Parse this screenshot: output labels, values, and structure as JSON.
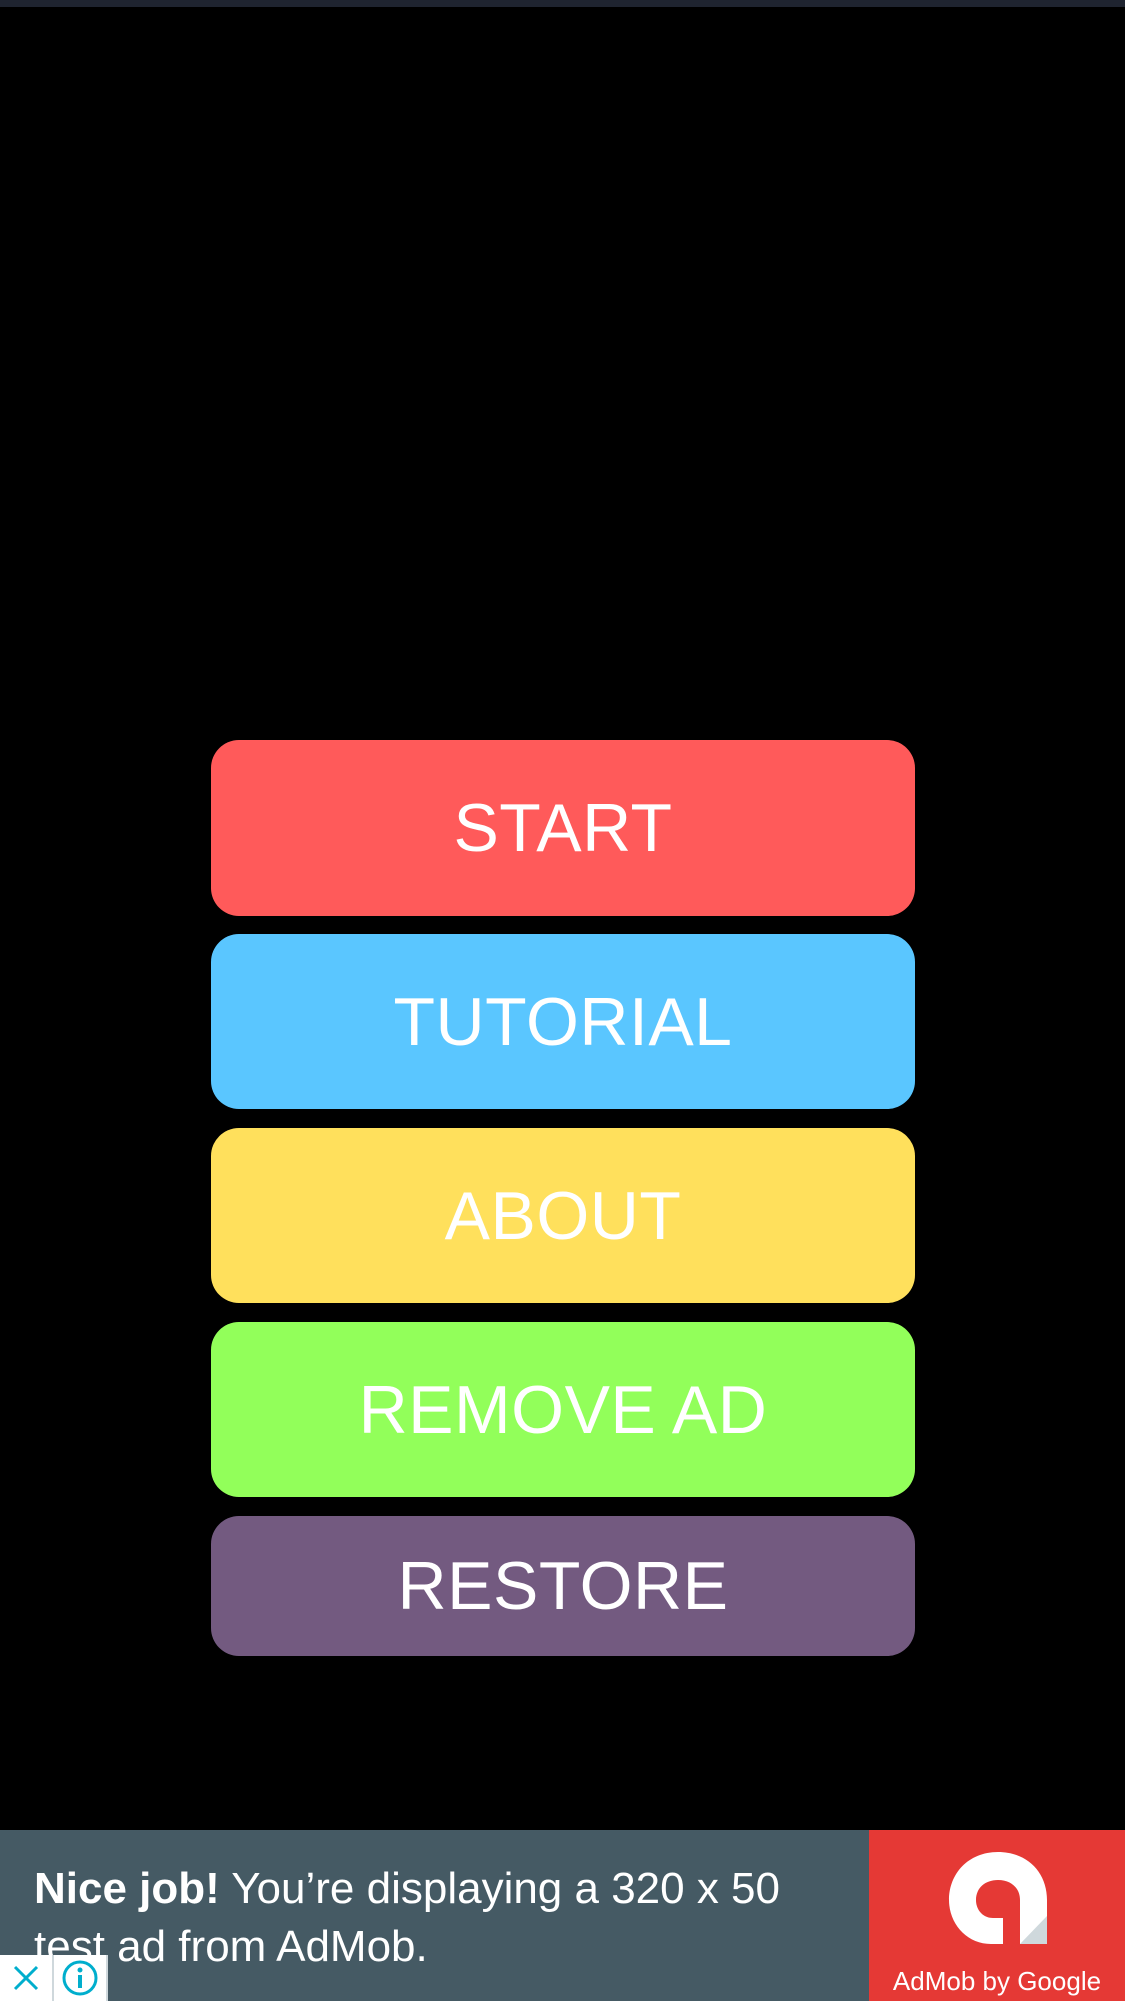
{
  "menu": {
    "buttons": [
      {
        "label": "START",
        "color": "#ff5a5a"
      },
      {
        "label": "TUTORIAL",
        "color": "#5ac6ff"
      },
      {
        "label": "ABOUT",
        "color": "#ffe05c"
      },
      {
        "label": "REMOVE AD",
        "color": "#92ff5a"
      },
      {
        "label": "RESTORE",
        "color": "#735a80"
      }
    ]
  },
  "ad": {
    "headline_bold": "Nice job!",
    "headline_rest": " You’re displaying a 320 x 50 test ad from AdMob.",
    "brand_label": "AdMob by Google",
    "brand_color": "#e53935",
    "background_color": "#455a64",
    "logo_icon": "admob-logo-icon",
    "close_icon": "close-icon",
    "info_icon": "info-icon"
  }
}
